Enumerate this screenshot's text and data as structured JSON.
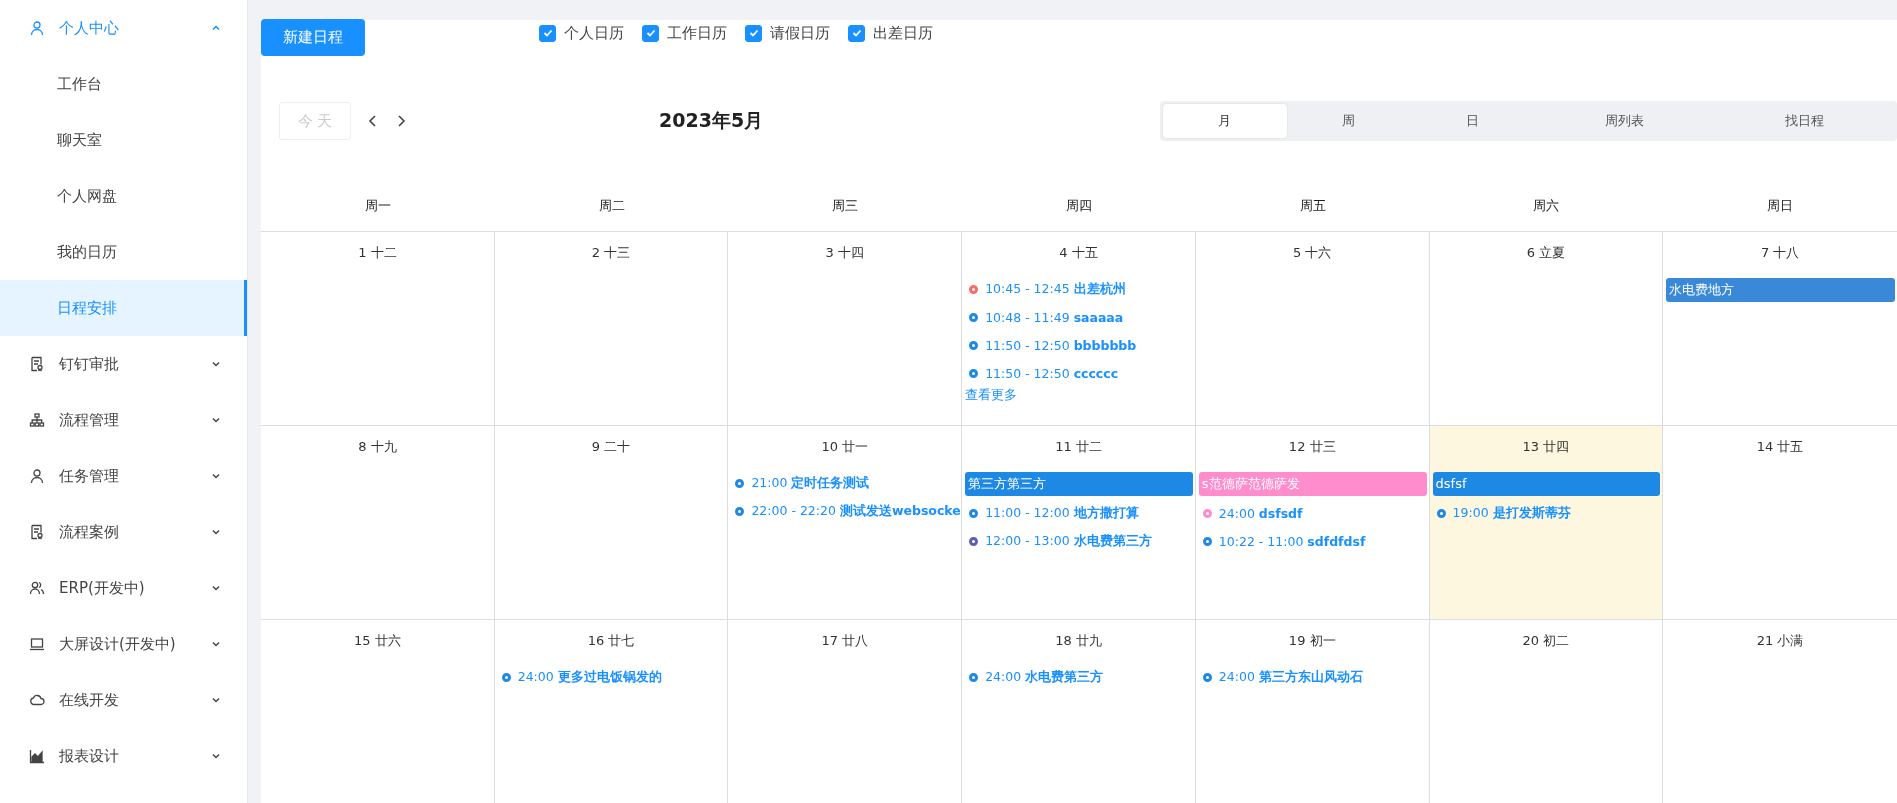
{
  "sidebar": {
    "items": [
      {
        "label": "个人中心",
        "expanded": true,
        "children": [
          {
            "label": "工作台",
            "selected": false
          },
          {
            "label": "聊天室",
            "selected": false
          },
          {
            "label": "个人网盘",
            "selected": false
          },
          {
            "label": "我的日历",
            "selected": false
          },
          {
            "label": "日程安排",
            "selected": true
          }
        ]
      },
      {
        "label": "钉钉审批",
        "expanded": false
      },
      {
        "label": "流程管理",
        "expanded": false
      },
      {
        "label": "任务管理",
        "expanded": false
      },
      {
        "label": "流程案例",
        "expanded": false
      },
      {
        "label": "ERP(开发中)",
        "expanded": false
      },
      {
        "label": "大屏设计(开发中)",
        "expanded": false
      },
      {
        "label": "在线开发",
        "expanded": false
      },
      {
        "label": "报表设计",
        "expanded": false
      }
    ]
  },
  "new_button": "新建日程",
  "calendars": [
    {
      "label": "个人日历",
      "checked": true
    },
    {
      "label": "工作日历",
      "checked": true
    },
    {
      "label": "请假日历",
      "checked": true
    },
    {
      "label": "出差日历",
      "checked": true
    }
  ],
  "toolbar": {
    "today_button": "今 天",
    "today_disabled": true,
    "title": "2023年5月",
    "views": [
      {
        "label": "月",
        "selected": true
      },
      {
        "label": "周",
        "selected": false
      },
      {
        "label": "日",
        "selected": false
      },
      {
        "label": "周列表",
        "selected": false
      },
      {
        "label": "找日程",
        "selected": false
      }
    ]
  },
  "weekdays": [
    "周一",
    "周二",
    "周三",
    "周四",
    "周五",
    "周六",
    "周日"
  ],
  "weeks": [
    {
      "days": [
        {
          "label": "1 十二",
          "today": false
        },
        {
          "label": "2 十三",
          "today": false
        },
        {
          "label": "3 十四",
          "today": false
        },
        {
          "label": "4 十五",
          "today": false,
          "events": [
            {
              "kind": "timed",
              "time": "10:45 - 12:45",
              "title": "出差杭州",
              "color": "#f56c6c"
            },
            {
              "kind": "timed",
              "time": "10:48 - 11:49",
              "title": "saaaaa",
              "color": "#1e88e5"
            },
            {
              "kind": "timed",
              "time": "11:50 - 12:50",
              "title": "bbbbbbb",
              "color": "#1e88e5"
            },
            {
              "kind": "timed",
              "time": "11:50 - 12:50",
              "title": "cccccc",
              "color": "#1e88e5"
            }
          ],
          "more": "查看更多"
        },
        {
          "label": "5 十六",
          "today": false
        },
        {
          "label": "6 立夏",
          "today": false
        },
        {
          "label": "7 十八",
          "today": false,
          "events": [
            {
              "kind": "allday",
              "title": "水电费地方",
              "color": "#3a89d9"
            }
          ]
        }
      ]
    },
    {
      "days": [
        {
          "label": "8 十九",
          "today": false
        },
        {
          "label": "9 二十",
          "today": false
        },
        {
          "label": "10 廿一",
          "today": false,
          "events": [
            {
              "kind": "timed",
              "time": "21:00",
              "title": "定时任务测试",
              "color": "#1e88e5"
            },
            {
              "kind": "timed",
              "time": "22:00 - 22:20",
              "title": "测试发送websocke",
              "color": "#1e88e5"
            }
          ]
        },
        {
          "label": "11 廿二",
          "today": false,
          "events": [
            {
              "kind": "allday",
              "title": "第三方第三方",
              "color": "#1e88e5"
            },
            {
              "kind": "timed",
              "time": "11:00 - 12:00",
              "title": "地方撒打算",
              "color": "#1e88e5"
            },
            {
              "kind": "timed",
              "time": "12:00 - 13:00",
              "title": "水电费第三方",
              "color": "#5c5fb0"
            }
          ]
        },
        {
          "label": "12 廿三",
          "today": false,
          "events": [
            {
              "kind": "allday",
              "title": "s范德萨范德萨发",
              "color": "#ff8ccc"
            },
            {
              "kind": "timed",
              "time": "24:00",
              "title": "dsfsdf",
              "color": "#ff8ccc"
            },
            {
              "kind": "timed",
              "time": "10:22 - 11:00",
              "title": "sdfdfdsf",
              "color": "#1e88e5"
            }
          ]
        },
        {
          "label": "13 廿四",
          "today": true,
          "events": [
            {
              "kind": "allday",
              "title": "dsfsf",
              "color": "#1e88e5"
            },
            {
              "kind": "timed",
              "time": "19:00",
              "title": "是打发斯蒂芬",
              "color": "#1e88e5"
            }
          ]
        },
        {
          "label": "14 廿五",
          "today": false
        }
      ]
    },
    {
      "days": [
        {
          "label": "15 廿六",
          "today": false
        },
        {
          "label": "16 廿七",
          "today": false,
          "events": [
            {
              "kind": "timed",
              "time": "24:00",
              "title": "更多过电饭锅发的",
              "color": "#1e88e5"
            }
          ]
        },
        {
          "label": "17 廿八",
          "today": false
        },
        {
          "label": "18 廿九",
          "today": false,
          "events": [
            {
              "kind": "timed",
              "time": "24:00",
              "title": "水电费第三方",
              "color": "#1e88e5"
            }
          ]
        },
        {
          "label": "19 初一",
          "today": false,
          "events": [
            {
              "kind": "timed",
              "time": "24:00",
              "title": "第三方东山风动石",
              "color": "#1e88e5"
            }
          ]
        },
        {
          "label": "20 初二",
          "today": false
        },
        {
          "label": "21 小满",
          "today": false
        }
      ]
    }
  ]
}
